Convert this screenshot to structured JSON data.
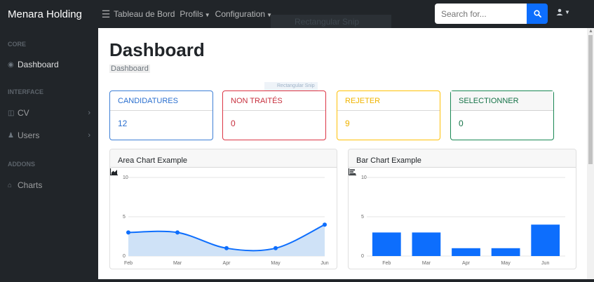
{
  "navbar": {
    "brand": "Menara Holding",
    "menu_icon": "bars-icon",
    "links": [
      {
        "label": "Tableau de Bord",
        "caret": false
      },
      {
        "label": "Profils",
        "caret": true
      },
      {
        "label": "Configuration",
        "caret": true
      }
    ],
    "overlay_text": "Rectangular Snip",
    "search": {
      "placeholder": "Search for...",
      "button_icon": "search-icon"
    },
    "user_icon": "user-icon"
  },
  "sidebar": {
    "sections": [
      {
        "heading": "CORE",
        "items": [
          {
            "label": "Dashboard",
            "icon": "tachometer-icon",
            "chevron": false
          }
        ]
      },
      {
        "heading": "INTERFACE",
        "items": [
          {
            "label": "CV",
            "icon": "columns-icon",
            "chevron": true
          },
          {
            "label": "Users",
            "icon": "user-icon",
            "chevron": true
          }
        ]
      },
      {
        "heading": "ADDONS",
        "items": [
          {
            "label": "Charts",
            "icon": "area-chart-icon",
            "chevron": false
          }
        ]
      }
    ]
  },
  "main": {
    "title": "Dashboard",
    "breadcrumb": "Dashboard",
    "overlay_text": "Rectangular Snip",
    "stats": [
      {
        "label": "CANDIDATURES",
        "value": "12",
        "color": "#2a6fcf"
      },
      {
        "label": "NON TRAITÉS",
        "value": "0",
        "color": "#c7303e"
      },
      {
        "label": "REJETER",
        "value": "9",
        "color": "#f0b400"
      },
      {
        "label": "SELECTIONNER",
        "value": "0",
        "color": "#167348"
      }
    ]
  },
  "chart_data": [
    {
      "type": "area",
      "title": "Area Chart Example",
      "categories": [
        "Feb",
        "Mar",
        "Apr",
        "May",
        "Jun"
      ],
      "series": [
        {
          "values": [
            3,
            3,
            1,
            1,
            4
          ]
        }
      ],
      "ylim": [
        0,
        10
      ],
      "yticks": [
        0,
        5,
        10
      ],
      "grid": true,
      "colors": {
        "line": "#0d6efd",
        "fill": "#cfe2f7"
      }
    },
    {
      "type": "bar",
      "title": "Bar Chart Example",
      "categories": [
        "Feb",
        "Mar",
        "Apr",
        "May",
        "Jun"
      ],
      "series": [
        {
          "values": [
            3,
            3,
            1,
            1,
            4
          ]
        }
      ],
      "ylim": [
        0,
        10
      ],
      "yticks": [
        0,
        5,
        10
      ],
      "grid": true,
      "colors": {
        "bar": "#0d6efd"
      }
    }
  ]
}
